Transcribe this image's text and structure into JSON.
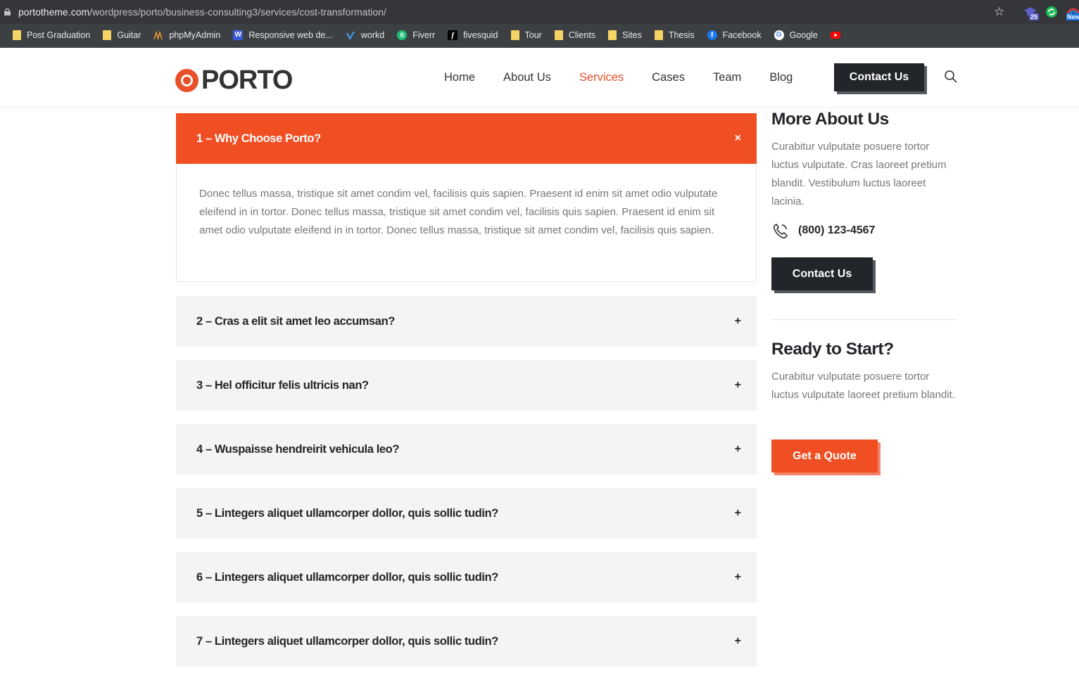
{
  "browser": {
    "url_host": "portotheme.com",
    "url_path": "/wordpress/porto/business-consulting3/services/cost-transformation/",
    "extension_badge": "25",
    "extension_new": "New",
    "bookmarks": [
      {
        "label": "Post Graduation",
        "icon": "folder-icon"
      },
      {
        "label": "Guitar",
        "icon": "folder-icon"
      },
      {
        "label": "phpMyAdmin",
        "icon": "phpmyadmin-icon"
      },
      {
        "label": "Responsive web de...",
        "icon": "w-icon"
      },
      {
        "label": "workd",
        "icon": "workd-icon"
      },
      {
        "label": "Fiverr",
        "icon": "fiverr-icon"
      },
      {
        "label": "fivesquid",
        "icon": "fivesquid-icon"
      },
      {
        "label": "Tour",
        "icon": "folder-icon"
      },
      {
        "label": "Clients",
        "icon": "folder-icon"
      },
      {
        "label": "Sites",
        "icon": "folder-icon"
      },
      {
        "label": "Thesis",
        "icon": "folder-icon"
      },
      {
        "label": "Facebook",
        "icon": "facebook-icon"
      },
      {
        "label": "Google",
        "icon": "google-icon"
      },
      {
        "label": "",
        "icon": "youtube-icon"
      }
    ]
  },
  "header": {
    "logo_text": "PORTO",
    "nav": [
      "Home",
      "About Us",
      "Services",
      "Cases",
      "Team",
      "Blog"
    ],
    "active_nav": "Services",
    "cta": "Contact Us"
  },
  "accordion": [
    {
      "title": "1 – Why Choose Porto?",
      "toggle": "×",
      "open": true,
      "body": "Donec tellus massa, tristique sit amet condim vel, facilisis quis sapien. Praesent id enim sit amet odio vulputate eleifend in in tortor. Donec tellus massa, tristique sit amet condim vel, facilisis quis sapien. Praesent id enim sit amet odio vulputate eleifend in in tortor. Donec tellus massa, tristique sit amet condim vel, facilisis quis sapien."
    },
    {
      "title": "2 – Cras a elit sit amet leo accumsan?",
      "toggle": "+"
    },
    {
      "title": "3 – Hel officitur felis ultricis nan?",
      "toggle": "+"
    },
    {
      "title": "4 – Wuspaisse hendreirit vehicula leo?",
      "toggle": "+"
    },
    {
      "title": "5 – Lintegers aliquet ullamcorper dollor, quis sollic tudin?",
      "toggle": "+"
    },
    {
      "title": "6 – Lintegers aliquet ullamcorper dollor, quis sollic tudin?",
      "toggle": "+"
    },
    {
      "title": "7 – Lintegers aliquet ullamcorper dollor, quis sollic tudin?",
      "toggle": "+"
    }
  ],
  "sidebar": {
    "more_title": "More About Us",
    "more_text": "Curabitur vulputate posuere tortor luctus vulputate. Cras laoreet pretium blandit. Vestibulum luctus laoreet lacinia.",
    "phone": "(800) 123-4567",
    "contact_btn": "Contact Us",
    "ready_title": "Ready to Start?",
    "ready_text": "Curabitur vulputate posuere tortor luctus vulputate laoreet pretium blandit.",
    "quote_btn": "Get a Quote"
  },
  "colors": {
    "accent": "#f04e23",
    "dark": "#22252a"
  }
}
